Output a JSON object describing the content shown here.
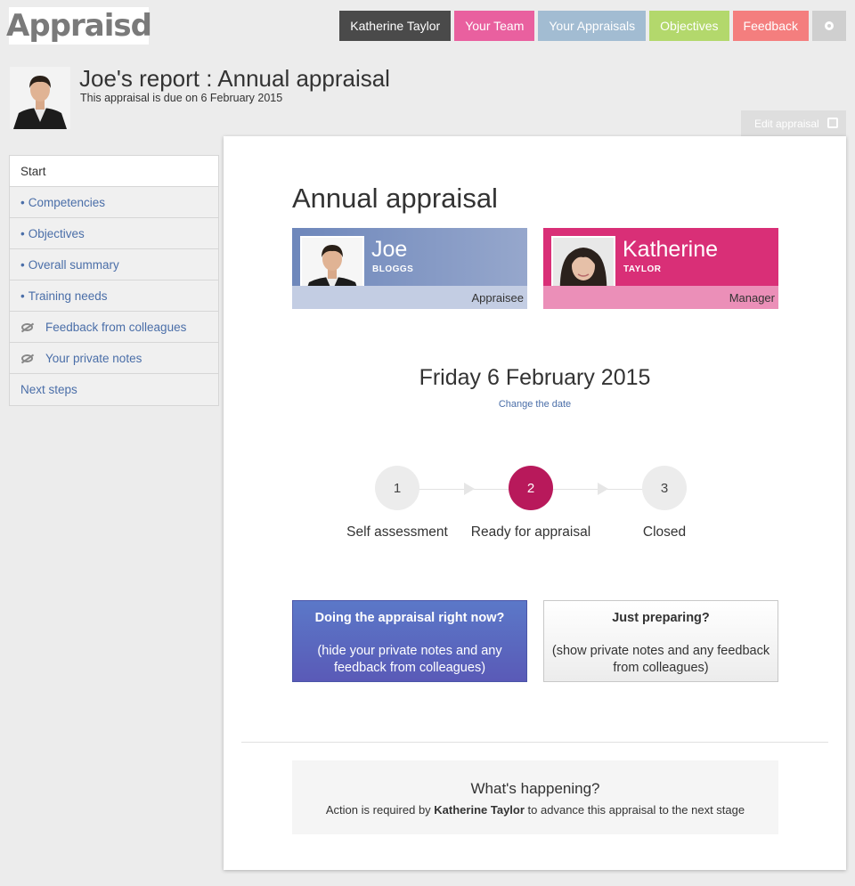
{
  "brand": {
    "logo": "Appraisd"
  },
  "topnav": {
    "user": "Katherine Taylor",
    "team": "Your Team",
    "appraisals": "Your Appraisals",
    "objectives": "Objectives",
    "feedback": "Feedback",
    "settings_icon": "gear-icon"
  },
  "header": {
    "title": "Joe's report : Annual appraisal",
    "subtitle": "This appraisal is due on 6 February 2015",
    "edit_label": "Edit appraisal",
    "print_icon": "printer-icon"
  },
  "sidebar": {
    "items": [
      {
        "label": "Start",
        "prefix": ""
      },
      {
        "label": "Competencies",
        "prefix": "•"
      },
      {
        "label": "Objectives",
        "prefix": "•"
      },
      {
        "label": "Overall summary",
        "prefix": "•"
      },
      {
        "label": "Training needs",
        "prefix": "•"
      },
      {
        "label": "Feedback from colleagues",
        "icon": "private-eye-icon"
      },
      {
        "label": "Your private notes",
        "icon": "private-eye-icon"
      },
      {
        "label": "Next steps",
        "prefix": ""
      }
    ]
  },
  "main": {
    "title": "Annual appraisal",
    "appraisee": {
      "first": "Joe",
      "last": "BLOGGS",
      "role": "Appraisee"
    },
    "manager": {
      "first": "Katherine",
      "last": "TAYLOR",
      "role": "Manager"
    },
    "date": "Friday 6 February 2015",
    "change_date": "Change the date",
    "steps": [
      {
        "number": "1",
        "label": "Self assessment"
      },
      {
        "number": "2",
        "label": "Ready for appraisal"
      },
      {
        "number": "3",
        "label": "Closed"
      }
    ],
    "mode_now": {
      "title": "Doing the appraisal right now?",
      "text": "(hide your private notes and any feedback from colleagues)"
    },
    "mode_prep": {
      "title": "Just preparing?",
      "text": "(show private notes and any feedback from colleagues)"
    },
    "whats_happening": {
      "heading": "What's happening?",
      "text_before": "Action is required by",
      "person": "Katherine Taylor",
      "text_after": "to advance this appraisal to the next stage"
    }
  },
  "colors": {
    "accent_blue": "#4a6ea8",
    "current_step": "#b8195b",
    "manager_pink": "#d92f77"
  }
}
